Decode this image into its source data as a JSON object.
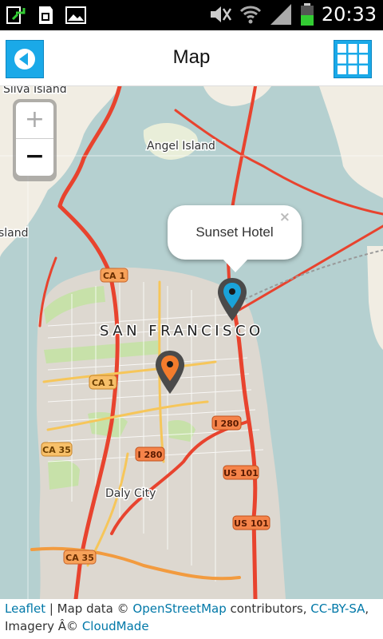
{
  "status_bar": {
    "time": "20:33",
    "icons": [
      "download-notification-icon",
      "sd-card-icon",
      "picture-icon",
      "mute-icon",
      "wifi-icon",
      "signal-icon",
      "battery-icon"
    ]
  },
  "app_bar": {
    "title": "Map",
    "back_icon": "back-arrow-icon",
    "menu_icon": "grid-menu-icon",
    "accent_color": "#1aa9e8"
  },
  "map": {
    "zoom_in_label": "+",
    "zoom_out_label": "−",
    "labels": {
      "silva_island": "Silva Island",
      "angel_island": "Angel Island",
      "island_left": "sland",
      "city": "SAN FRANCISCO",
      "daly_city": "Daly City"
    },
    "shields": {
      "ca1_top": "CA 1",
      "ca1_mid": "CA 1",
      "ca35_top": "CA 35",
      "ca35_bottom": "CA 35",
      "i280_a": "I 280",
      "i280_b": "I 280",
      "us101_a": "US 101",
      "us101_b": "US 101"
    },
    "popup": {
      "text": "Sunset Hotel",
      "close": "×"
    },
    "markers": [
      {
        "name": "blue-marker",
        "color": "#1aa3d9"
      },
      {
        "name": "orange-marker",
        "color": "#f47c2c"
      }
    ]
  },
  "attribution": {
    "leaflet": "Leaflet",
    "sep": " | Map data © ",
    "osm": "OpenStreetMap",
    "contributors": " contributors, ",
    "license": "CC-BY-SA",
    "comma": ",",
    "imagery": "Imagery Â© ",
    "cloudmade": "CloudMade"
  }
}
